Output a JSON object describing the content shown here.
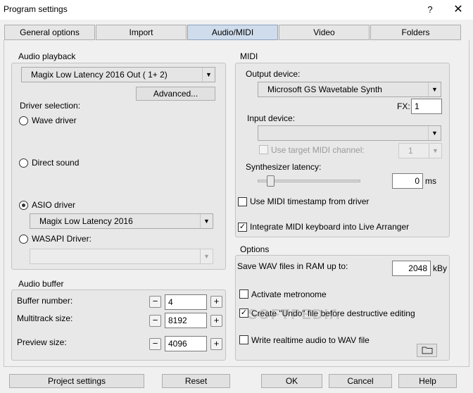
{
  "window": {
    "title": "Program settings",
    "help_glyph": "?",
    "close_glyph": "✕"
  },
  "tabs": [
    {
      "label": "General options"
    },
    {
      "label": "Import"
    },
    {
      "label": "Audio/MIDI",
      "active": true
    },
    {
      "label": "Video"
    },
    {
      "label": "Folders"
    }
  ],
  "audio_playback": {
    "title": "Audio playback",
    "device": "Magix Low Latency 2016 Out ( 1+ 2)",
    "advanced_label": "Advanced...",
    "driver_selection_label": "Driver selection:",
    "drivers": [
      {
        "label": "Wave driver",
        "selected": false
      },
      {
        "label": "Direct sound",
        "selected": false
      },
      {
        "label": "ASIO driver",
        "selected": true
      },
      {
        "label": "WASAPI Driver:",
        "selected": false
      }
    ],
    "asio_device": "Magix Low Latency 2016",
    "wasapi_device": ""
  },
  "midi": {
    "title": "MIDI",
    "output_label": "Output device:",
    "output_device": "Microsoft GS Wavetable Synth",
    "fx_label": "FX:",
    "fx_value": "1",
    "input_label": "Input device:",
    "input_device": "",
    "use_target_channel_label": "Use target MIDI channel:",
    "target_channel_value": "1",
    "synth_latency_label": "Synthesizer latency:",
    "synth_latency_value": "0",
    "synth_latency_unit": "ms",
    "use_timestamp_label": "Use MIDI timestamp from driver",
    "use_timestamp_checked": false,
    "integrate_keyboard_label": "Integrate MIDI keyboard into Live Arranger",
    "integrate_keyboard_checked": true
  },
  "audio_buffer": {
    "title": "Audio buffer",
    "rows": [
      {
        "label": "Buffer number:",
        "value": "4"
      },
      {
        "label": "Multitrack size:",
        "value": "8192"
      },
      {
        "label": "Preview size:",
        "value": "4096"
      }
    ],
    "minus_glyph": "−",
    "plus_glyph": "+"
  },
  "options": {
    "title": "Options",
    "save_wav_label": "Save WAV files in RAM up to:",
    "save_wav_value": "2048",
    "save_wav_unit": "kBy",
    "activate_metronome_label": "Activate metronome",
    "activate_metronome_checked": false,
    "create_undo_label": "Create \"Undo\" file before destructive editing",
    "create_undo_checked": true,
    "write_realtime_label": "Write realtime audio to WAV file",
    "write_realtime_checked": false
  },
  "watermark": "SOFTPEDIA",
  "footer": {
    "project_settings_label": "Project settings",
    "reset_label": "Reset",
    "ok_label": "OK",
    "cancel_label": "Cancel",
    "help_label": "Help"
  }
}
